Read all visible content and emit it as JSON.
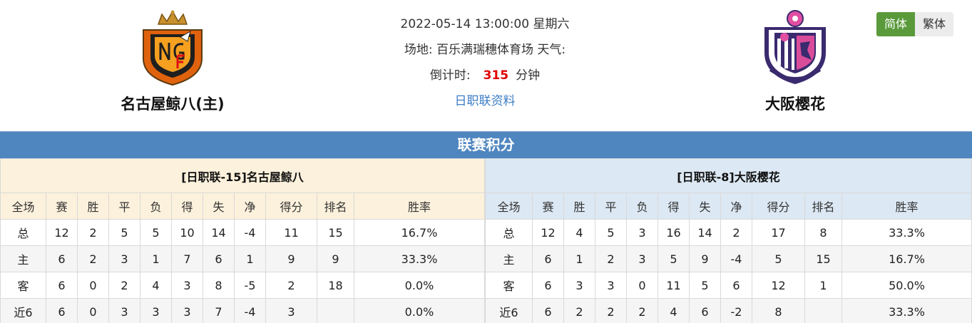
{
  "match": {
    "datetime": "2022-05-14 13:00:00 星期六",
    "venue_label": "场地:",
    "venue": "百乐满瑞穗体育场",
    "weather_label": "天气:",
    "countdown_label": "倒计时:",
    "countdown_value": "315",
    "countdown_unit": "分钟",
    "league_link": "日职联资料"
  },
  "home_team": {
    "name": "名古屋鲸八(主)"
  },
  "away_team": {
    "name": "大阪樱花"
  },
  "lang": {
    "simplified": "简体",
    "traditional": "繁体"
  },
  "section_title": "联赛积分",
  "columns": [
    "全场",
    "赛",
    "胜",
    "平",
    "负",
    "得",
    "失",
    "净",
    "得分",
    "排名",
    "胜率"
  ],
  "standings_home": {
    "header": "[日职联-15]名古屋鲸八",
    "rows": [
      [
        "总",
        "12",
        "2",
        "5",
        "5",
        "10",
        "14",
        "-4",
        "11",
        "15",
        "16.7%"
      ],
      [
        "主",
        "6",
        "2",
        "3",
        "1",
        "7",
        "6",
        "1",
        "9",
        "9",
        "33.3%"
      ],
      [
        "客",
        "6",
        "0",
        "2",
        "4",
        "3",
        "8",
        "-5",
        "2",
        "18",
        "0.0%"
      ],
      [
        "近6",
        "6",
        "0",
        "3",
        "3",
        "3",
        "7",
        "-4",
        "3",
        "",
        "0.0%"
      ]
    ]
  },
  "standings_away": {
    "header": "[日职联-8]大阪樱花",
    "rows": [
      [
        "总",
        "12",
        "4",
        "5",
        "3",
        "16",
        "14",
        "2",
        "17",
        "8",
        "33.3%"
      ],
      [
        "主",
        "6",
        "1",
        "2",
        "3",
        "5",
        "9",
        "-4",
        "5",
        "15",
        "16.7%"
      ],
      [
        "客",
        "6",
        "3",
        "3",
        "0",
        "11",
        "5",
        "6",
        "12",
        "1",
        "50.0%"
      ],
      [
        "近6",
        "6",
        "2",
        "2",
        "2",
        "4",
        "6",
        "-2",
        "8",
        "",
        "33.3%"
      ]
    ]
  },
  "colors": {
    "section_bar": "#4f86c0",
    "home_header_bg": "#fcf1dc",
    "away_header_bg": "#dce8f3",
    "countdown": "#e00000",
    "link": "#3d7ec5",
    "lang_active": "#5a9a3b",
    "home_label": "#d71a1a",
    "away_label": "#1a3fc9"
  },
  "icons": {
    "home_logo": "nagoya-grampus-crest-icon",
    "away_logo": "cerezo-osaka-crest-icon"
  }
}
